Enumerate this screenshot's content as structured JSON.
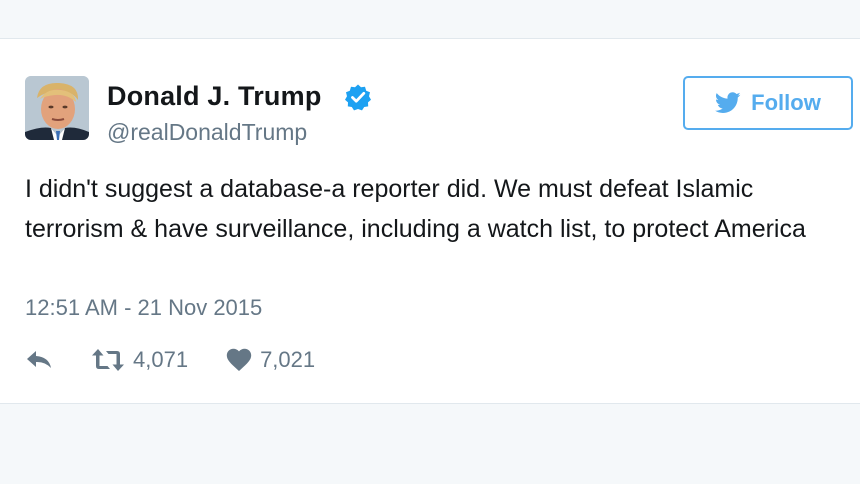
{
  "tweet": {
    "author": {
      "name": "Donald J. Trump",
      "handle": "@realDonaldTrump",
      "verified": true,
      "avatar_icon": "profile-photo"
    },
    "follow_button": {
      "label": "Follow",
      "icon": "twitter-bird-icon"
    },
    "text": "I didn't suggest a database-a reporter did. We must defeat Islamic terrorism & have surveillance, including a watch list, to protect America",
    "timestamp": "12:51 AM - 21 Nov 2015",
    "actions": {
      "reply_icon": "reply-icon",
      "retweet_icon": "retweet-icon",
      "retweet_count": "4,071",
      "like_icon": "heart-icon",
      "like_count": "7,021"
    }
  },
  "colors": {
    "brand_blue": "#55acee",
    "verified_blue": "#1da1f2",
    "text_primary": "#14171a",
    "text_secondary": "#657786",
    "background": "#f5f8fa",
    "card": "#ffffff"
  }
}
